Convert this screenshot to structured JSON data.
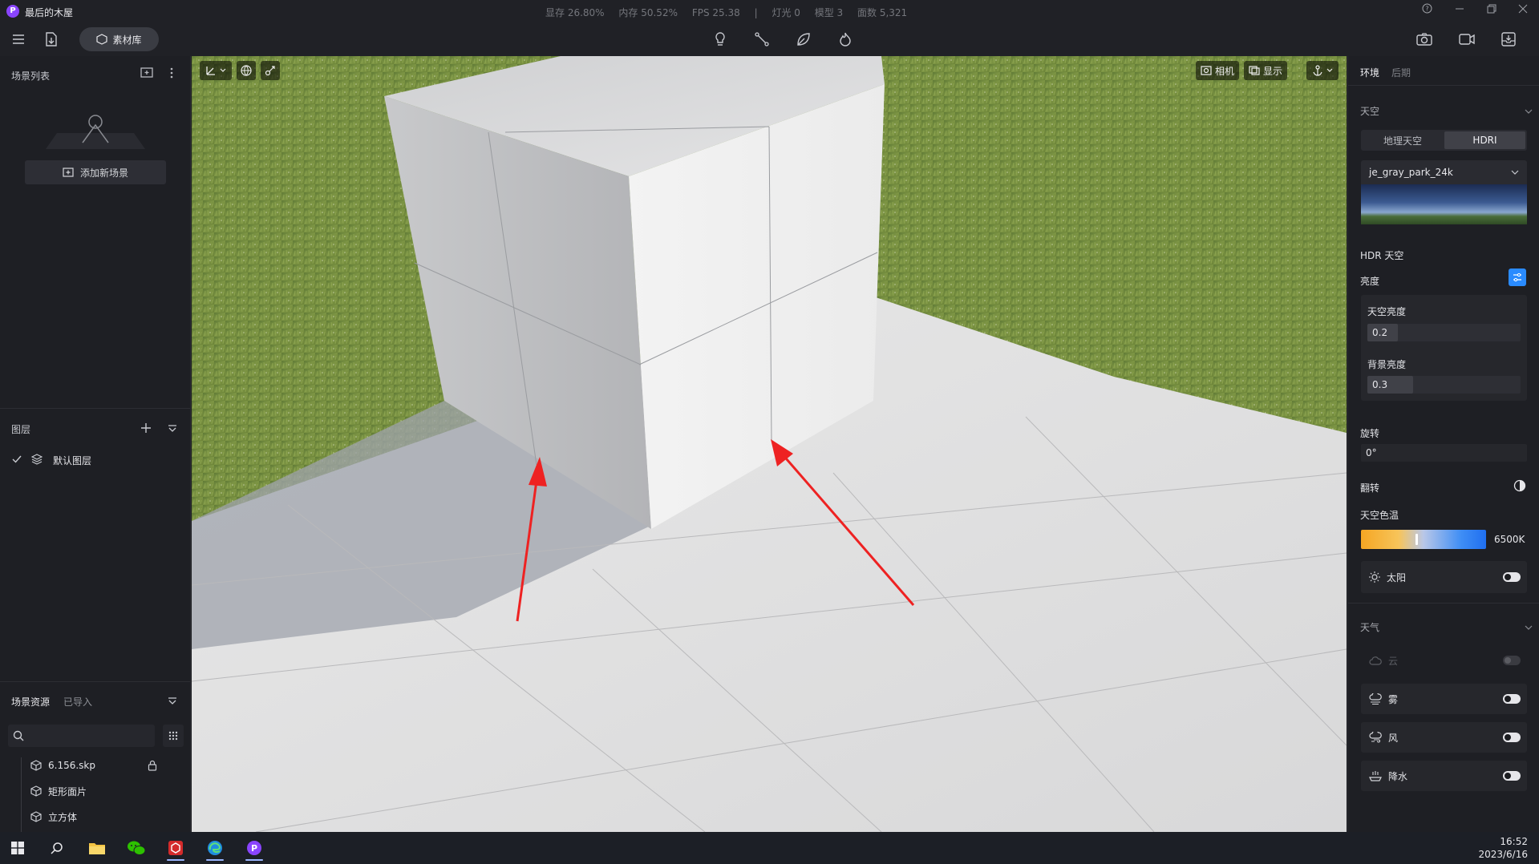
{
  "app": {
    "logo_letter": "P",
    "title": "最后的木屋"
  },
  "stats": {
    "vram": "显存 26.80%",
    "memory": "内存 50.52%",
    "fps": "FPS 25.38",
    "separator": "|",
    "lights": "灯光 0",
    "models": "模型 3",
    "faces": "面数 5,321"
  },
  "toolbar": {
    "material_library": "素材库"
  },
  "left_panel": {
    "scene_list": {
      "title": "场景列表",
      "add_scene": "添加新场景"
    },
    "layers": {
      "title": "图层",
      "items": [
        {
          "label": "默认图层",
          "visible": true
        }
      ]
    },
    "assets": {
      "tab_scene": "场景资源",
      "tab_imported": "已导入",
      "search_placeholder": "",
      "items": [
        {
          "label": "6.156.skp",
          "locked": true
        },
        {
          "label": "矩形面片",
          "locked": false
        },
        {
          "label": "立方体",
          "locked": false
        }
      ]
    }
  },
  "viewport": {
    "camera_label": "相机",
    "display_label": "显示"
  },
  "right_panel": {
    "tabs": {
      "environment": "环境",
      "post": "后期"
    },
    "sky": {
      "title": "天空",
      "mode_physical": "地理天空",
      "mode_hdri": "HDRI",
      "active_mode": "HDRI",
      "hdri_name": "je_gray_park_24k",
      "hdr_sky_label": "HDR 天空",
      "brightness_label": "亮度",
      "sky_brightness_label": "天空亮度",
      "sky_brightness_value": "0.2",
      "sky_brightness_level": 0.2,
      "bg_brightness_label": "背景亮度",
      "bg_brightness_value": "0.3",
      "bg_brightness_level": 0.3,
      "rotation_label": "旋转",
      "rotation_value": "0°",
      "flip_label": "翻转",
      "color_temp_label": "天空色温",
      "color_temp_value": "6500K",
      "sun_label": "太阳",
      "sun_on": false
    },
    "weather": {
      "title": "天气",
      "items": [
        {
          "label": "云",
          "enabled": false
        },
        {
          "label": "雾",
          "enabled": true
        },
        {
          "label": "风",
          "enabled": true
        },
        {
          "label": "降水",
          "enabled": true
        }
      ]
    }
  },
  "taskbar": {
    "time": "16:52",
    "date": "2023/6/16"
  },
  "colors": {
    "accent": "#2a8bff",
    "annotation_arrow": "#ee2222",
    "app_logo": "#8a44ff"
  }
}
